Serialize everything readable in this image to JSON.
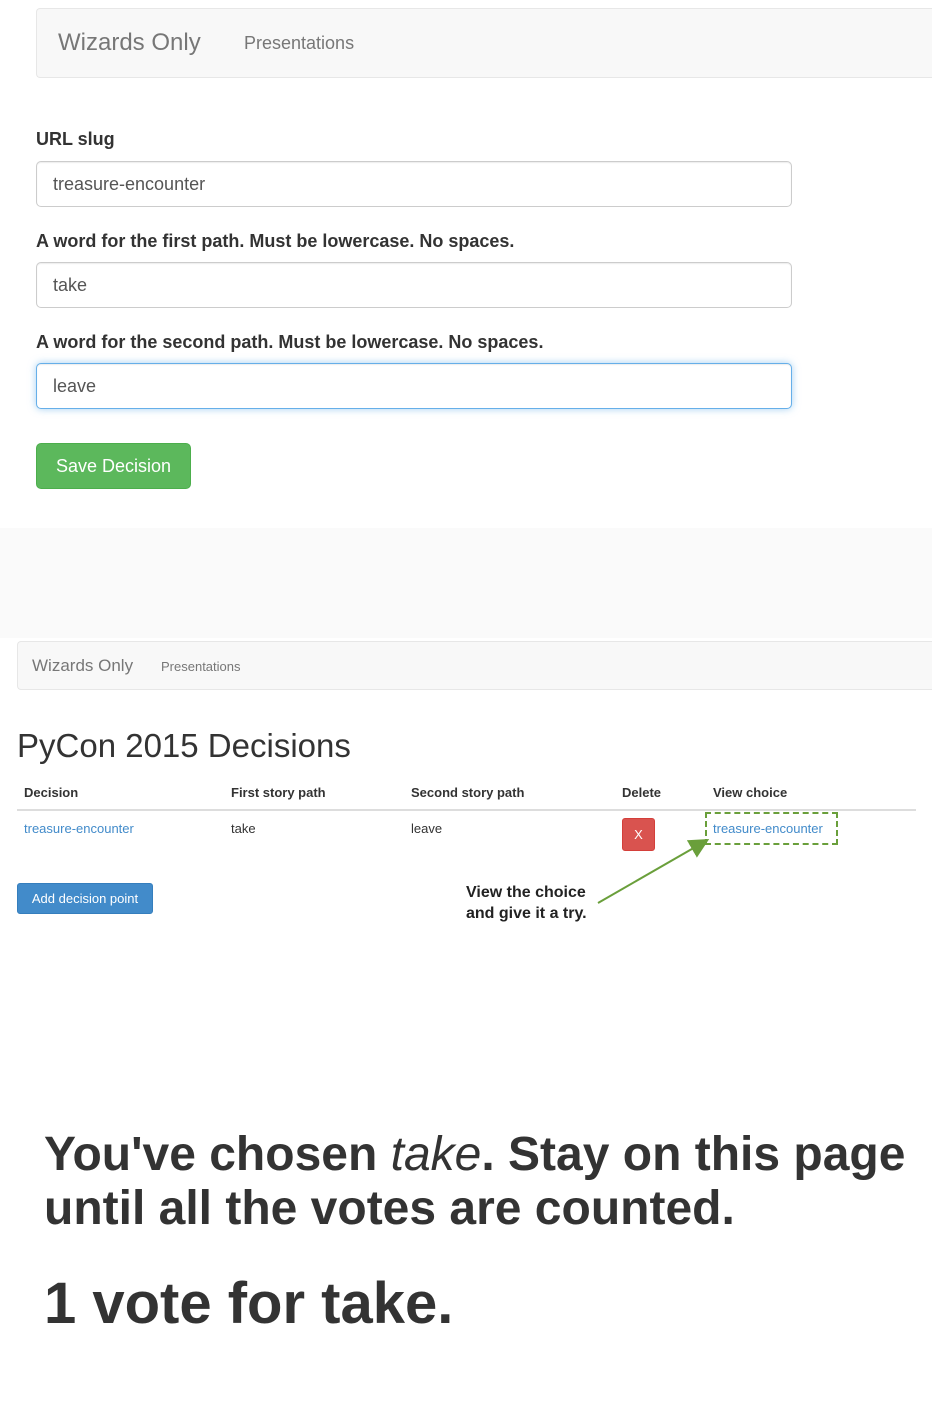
{
  "panel1": {
    "navbar": {
      "brand": "Wizards Only",
      "link": "Presentations"
    },
    "form": {
      "slug_label": "URL slug",
      "slug_value": "treasure-encounter",
      "first_label": "A word for the first path. Must be lowercase. No spaces.",
      "first_value": "take",
      "second_label": "A word for the second path. Must be lowercase. No spaces.",
      "second_value": "leave",
      "save_label": "Save Decision"
    }
  },
  "panel2": {
    "navbar": {
      "brand": "Wizards Only",
      "link": "Presentations"
    },
    "heading": "PyCon 2015 Decisions",
    "table": {
      "headers": [
        "Decision",
        "First story path",
        "Second story path",
        "Delete",
        "View choice"
      ],
      "rows": [
        {
          "decision": "treasure-encounter",
          "first": "take",
          "second": "leave",
          "delete": "X",
          "view": "treasure-encounter"
        }
      ]
    },
    "add_label": "Add decision point",
    "annotation_line1": "View the choice",
    "annotation_line2": "and give it a try.",
    "annotation_color": "#6a9f3b"
  },
  "panel3": {
    "msg_before": "You've chosen ",
    "msg_choice": "take",
    "msg_after": ". Stay on this page until all the votes are counted.",
    "vote_count": "1 vote for take."
  }
}
